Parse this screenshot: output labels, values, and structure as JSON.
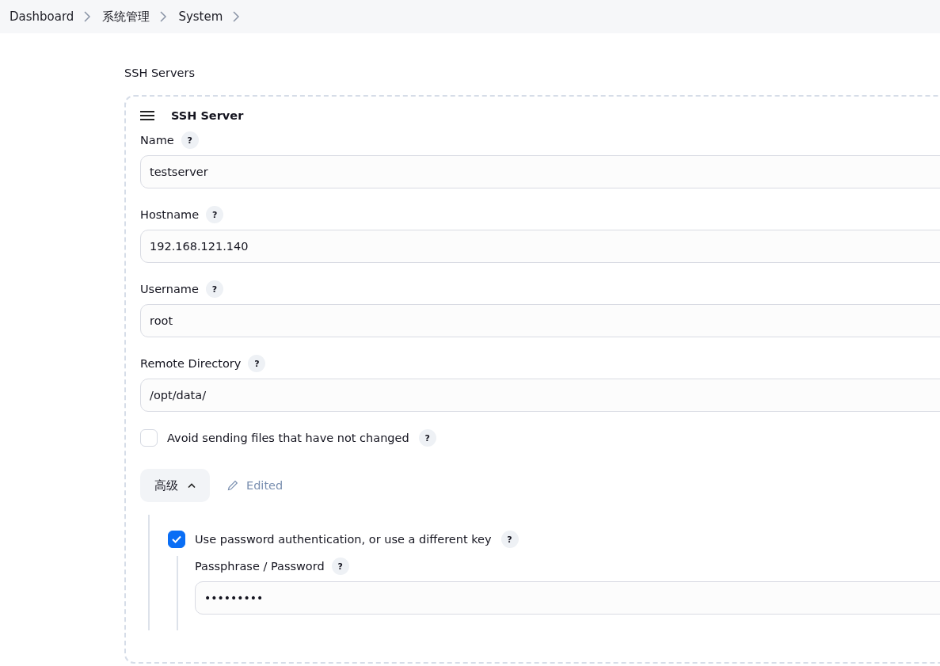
{
  "breadcrumbs": [
    {
      "label": "Dashboard"
    },
    {
      "label": "系统管理"
    },
    {
      "label": "System"
    }
  ],
  "section_title": "SSH Servers",
  "server": {
    "title": "SSH Server",
    "fields": [
      {
        "label": "Name",
        "value": "testserver"
      },
      {
        "label": "Hostname",
        "value": "192.168.121.140"
      },
      {
        "label": "Username",
        "value": "root"
      },
      {
        "label": "Remote Directory",
        "value": "/opt/data/"
      }
    ],
    "avoid_unchanged": {
      "label": "Avoid sending files that have not changed",
      "checked": false
    },
    "advanced_button": {
      "label": "高级",
      "expanded": true
    },
    "edited_label": "Edited",
    "password_auth": {
      "label": "Use password authentication, or use a different key",
      "checked": true
    },
    "passphrase": {
      "label": "Passphrase / Password",
      "value": "•••••••••"
    },
    "help_mark": "?"
  }
}
